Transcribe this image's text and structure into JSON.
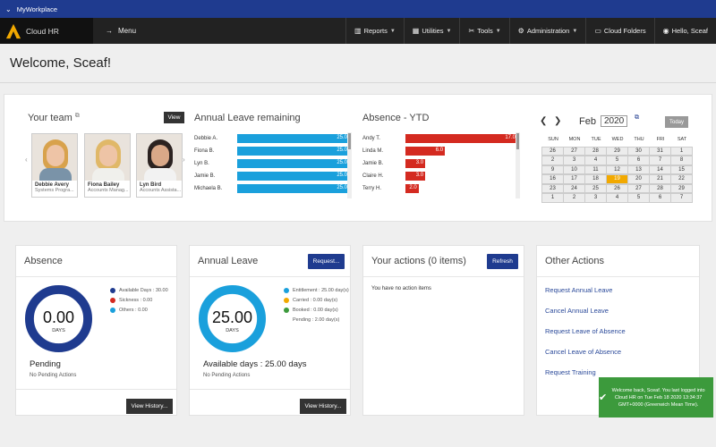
{
  "topbar": {
    "label": "MyWorkplace"
  },
  "nav": {
    "brand": "Cloud HR",
    "menu": "Menu",
    "items": [
      {
        "label": "Reports",
        "icon": "bar-chart-icon"
      },
      {
        "label": "Utilities",
        "icon": "grid-icon"
      },
      {
        "label": "Tools",
        "icon": "wrench-icon"
      },
      {
        "label": "Administration",
        "icon": "gear-icon"
      },
      {
        "label": "Cloud Folders",
        "icon": "folder-icon"
      },
      {
        "label": "Hello, Sceaf",
        "icon": "user-icon"
      }
    ]
  },
  "welcome": "Welcome, Sceaf!",
  "team": {
    "title": "Your team",
    "view_label": "View",
    "members": [
      {
        "name": "Debbie Avery",
        "role": "Systems Progra...",
        "hair": "#d8a24c",
        "top": "#7a93a8"
      },
      {
        "name": "Fiona Bailey",
        "role": "Accounts Manag...",
        "hair": "#e0b868",
        "top": "#f0f0ec"
      },
      {
        "name": "Lyn Bird",
        "role": "Accounts Assista...",
        "hair": "#2b2220",
        "top": "#f2f2f2"
      }
    ]
  },
  "annual_leave_remaining": {
    "title": "Annual Leave remaining",
    "color": "#1aa0dc",
    "max": 25,
    "rows": [
      {
        "name": "Debbie A.",
        "value": "25.0"
      },
      {
        "name": "Fiona B.",
        "value": "25.0"
      },
      {
        "name": "Lyn B.",
        "value": "25.0"
      },
      {
        "name": "Jamie B.",
        "value": "25.0"
      },
      {
        "name": "Michaela B.",
        "value": "25.0"
      }
    ]
  },
  "absence_ytd": {
    "title": "Absence - YTD",
    "color": "#d42a20",
    "max": 17,
    "rows": [
      {
        "name": "Andy T.",
        "value": "17.0"
      },
      {
        "name": "Linda M.",
        "value": "6.0"
      },
      {
        "name": "Jamie B.",
        "value": "3.0"
      },
      {
        "name": "Claire H.",
        "value": "3.0"
      },
      {
        "name": "Terry H.",
        "value": "2.0"
      }
    ]
  },
  "calendar": {
    "prev": "❮",
    "next": "❯",
    "month": "Feb",
    "year": "2020",
    "today_label": "Today",
    "dow": [
      "SUN",
      "MON",
      "TUE",
      "WED",
      "THU",
      "FRI",
      "SAT"
    ],
    "weeks": [
      [
        "26",
        "27",
        "28",
        "29",
        "30",
        "31",
        "1"
      ],
      [
        "2",
        "3",
        "4",
        "5",
        "6",
        "7",
        "8"
      ],
      [
        "9",
        "10",
        "11",
        "12",
        "13",
        "14",
        "15"
      ],
      [
        "16",
        "17",
        "18",
        "19",
        "20",
        "21",
        "22"
      ],
      [
        "23",
        "24",
        "25",
        "26",
        "27",
        "28",
        "29"
      ],
      [
        "1",
        "2",
        "3",
        "4",
        "5",
        "6",
        "7"
      ]
    ],
    "today": "19"
  },
  "absence_panel": {
    "title": "Absence",
    "donut_value": "0.00",
    "donut_unit": "DAYS",
    "ring_color": "#1f3b8f",
    "legend": [
      {
        "label": "Available Days : 30.00",
        "color": "#1f3b8f"
      },
      {
        "label": "Sickness : 0.00",
        "color": "#d42a20"
      },
      {
        "label": "Others : 0.00",
        "color": "#1aa0dc"
      }
    ],
    "status_heading": "Pending",
    "status_text": "No Pending Actions",
    "history_button": "View History..."
  },
  "annual_leave_panel": {
    "title": "Annual Leave",
    "request_button": "Request...",
    "donut_value": "25.00",
    "donut_unit": "DAYS",
    "ring_color": "#1aa0dc",
    "legend": [
      {
        "label": "Entitlement : 25.00 day(s)",
        "color": "#1aa0dc"
      },
      {
        "label": "Carried : 0.00 day(s)",
        "color": "#f2a900"
      },
      {
        "label": "Booked : 0.00 day(s)",
        "color": "#3c9a3c"
      },
      {
        "label": "Pending : 2.00 day(s)",
        "color": ""
      }
    ],
    "status_heading": "Available days : 25.00 days",
    "status_text": "No Pending Actions",
    "history_button": "View History..."
  },
  "actions_panel": {
    "title": "Your actions (0 items)",
    "refresh_button": "Refresh",
    "empty_text": "You have no action items"
  },
  "other_actions": {
    "title": "Other Actions",
    "links": [
      "Request Annual Leave",
      "Cancel Annual Leave",
      "Request Leave of Absence",
      "Cancel Leave of Absence",
      "Request Training"
    ]
  },
  "toast": {
    "text": "Welcome back, Sceaf. You last logged into Cloud HR on Tue Feb 18 2020 13:34:37 GMT+0000 (Greenwich Mean Time)."
  }
}
